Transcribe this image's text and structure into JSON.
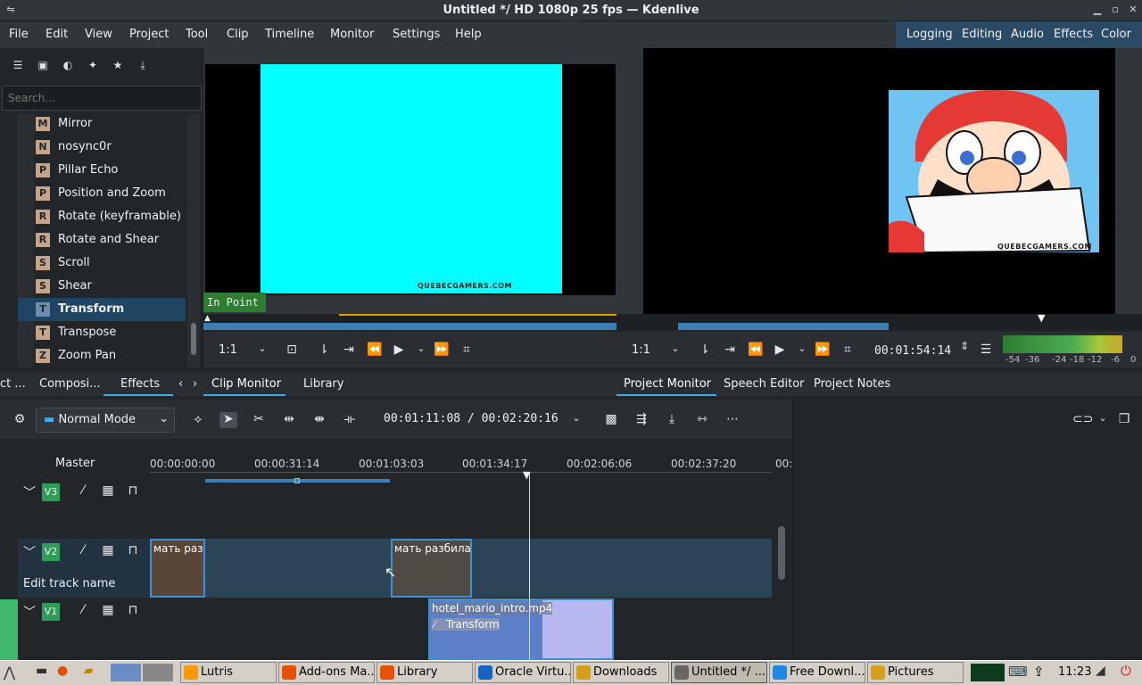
{
  "window": {
    "title": "Untitled */ HD 1080p 25 fps — Kdenlive"
  },
  "menu": [
    "File",
    "Edit",
    "View",
    "Project",
    "Tool",
    "Clip",
    "Timeline",
    "Monitor",
    "Settings",
    "Help"
  ],
  "layouts": [
    "Logging",
    "Editing",
    "Audio",
    "Effects",
    "Color"
  ],
  "effects_panel": {
    "search_placeholder": "Search...",
    "items": [
      {
        "letter": "M",
        "label": "Mirror"
      },
      {
        "letter": "N",
        "label": "nosync0r"
      },
      {
        "letter": "P",
        "label": "Pillar Echo"
      },
      {
        "letter": "P",
        "label": "Position and Zoom"
      },
      {
        "letter": "R",
        "label": "Rotate (keyframable)"
      },
      {
        "letter": "R",
        "label": "Rotate and Shear"
      },
      {
        "letter": "S",
        "label": "Scroll"
      },
      {
        "letter": "S",
        "label": "Shear"
      },
      {
        "letter": "T",
        "label": "Transform",
        "selected": true
      },
      {
        "letter": "T",
        "label": "Transpose"
      },
      {
        "letter": "Z",
        "label": "Zoom Pan"
      }
    ],
    "tabs": [
      "ct ...",
      "Composi...",
      "Effects"
    ]
  },
  "clip_monitor": {
    "in_point": "In Point",
    "watermark": "QUEBECGAMERS.COM",
    "zoom": "1:1",
    "tabs": [
      "Clip Monitor",
      "Library"
    ]
  },
  "project_monitor": {
    "watermark": "QUEBECGAMERS.COM",
    "zoom": "1:1",
    "timecode": "00:01:54:14",
    "tabs": [
      "Project Monitor",
      "Speech Editor",
      "Project Notes"
    ],
    "vu_labels": [
      "-54",
      "-36",
      "-24",
      "-18",
      "-12",
      "-6",
      "0"
    ]
  },
  "timeline": {
    "mode": "Normal Mode",
    "timecode": "00:01:11:08 / 00:02:20:16",
    "master": "Master",
    "ticks": [
      "00:00:00:00",
      "00:00:31:14",
      "00:01:03:03",
      "00:01:34:17",
      "00:02:06:06",
      "00:02:37:20",
      "00:"
    ],
    "tracks": [
      {
        "tag": "V3"
      },
      {
        "tag": "V2",
        "name": "Edit track name"
      },
      {
        "tag": "V1"
      }
    ],
    "clips": {
      "v2a": "мать раз",
      "v2b": "мать разбила",
      "v1a": "hotel_mario_intro.mp4",
      "v1a_effect": "Transform"
    }
  },
  "taskbar": {
    "tasks": [
      "Lutris",
      "Add-ons Ma...",
      "Library",
      "Oracle Virtu...",
      "Downloads",
      "Untitled */ ...",
      "Free Downl...",
      "Pictures"
    ],
    "clock": "11:23"
  }
}
